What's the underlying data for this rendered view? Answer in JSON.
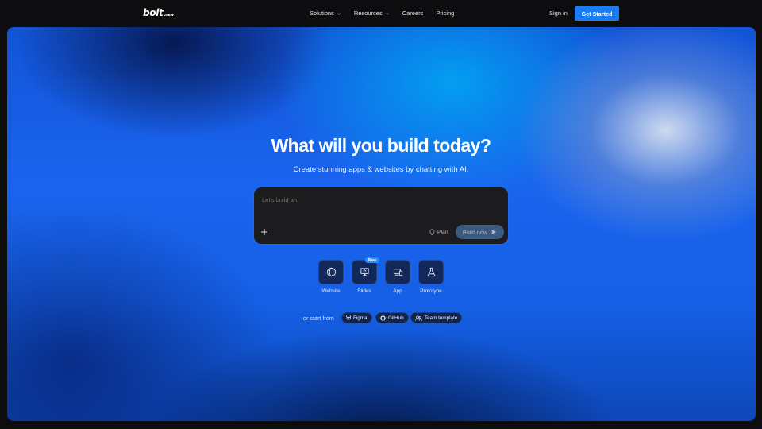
{
  "nav": {
    "logo_text": "bolt",
    "logo_suffix": ".new",
    "links": [
      "Solutions",
      "Resources",
      "Careers",
      "Pricing"
    ],
    "sign_in": "Sign in",
    "get_started": "Get Started"
  },
  "hero": {
    "title": "What will you build today?",
    "subtitle": "Create stunning apps & websites by chatting with AI."
  },
  "prompt": {
    "placeholder": "Let's build an",
    "plan_label": "Plan",
    "build_label": "Build now"
  },
  "tiles": {
    "items": [
      {
        "label": "Website",
        "icon": "globe-icon"
      },
      {
        "label": "Slides",
        "icon": "presentation-icon",
        "badge": "New"
      },
      {
        "label": "App",
        "icon": "devices-icon"
      },
      {
        "label": "Prototype",
        "icon": "flask-icon"
      }
    ]
  },
  "start_from": {
    "label": "or start from",
    "options": [
      {
        "label": "Figma",
        "icon": "figma-icon"
      },
      {
        "label": "GitHub",
        "icon": "github-icon"
      },
      {
        "label": "Team template",
        "icon": "team-icon"
      }
    ]
  },
  "colors": {
    "accent": "#1b7cf3",
    "background": "#0d0d0f",
    "prompt_bg": "#1c1c1f",
    "build_button": "#3b5a7e",
    "tile_bg": "#12285a"
  }
}
